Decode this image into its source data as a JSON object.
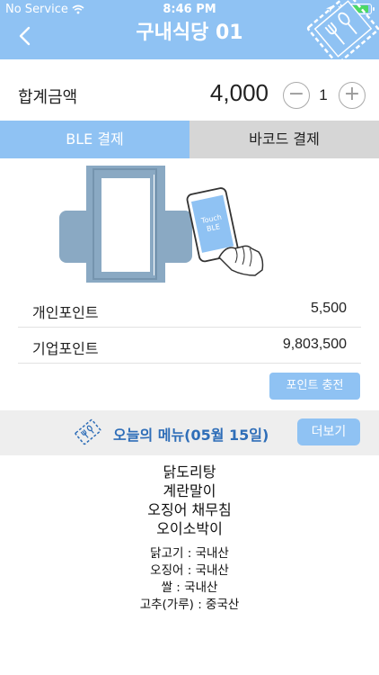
{
  "status_bar": {
    "carrier": "No Service",
    "time": "8:46 PM",
    "battery_level": 0.9
  },
  "header": {
    "title": "구내식당 01",
    "back_icon": "chevron-left-icon",
    "badge_icon": "fork-spoon-icon",
    "accent_color": "#8fc2f3"
  },
  "order": {
    "total_label": "합계금액",
    "total_amount": "4,000",
    "minus_label": "−",
    "quantity": "1",
    "plus_label": "+"
  },
  "tabs": [
    {
      "label": "BLE 결제",
      "active": true
    },
    {
      "label": "바코드 결제",
      "active": false
    }
  ],
  "illustration": {
    "phone_text_line1": "Touch",
    "phone_text_line2": "BLE"
  },
  "points": [
    {
      "label": "개인포인트",
      "value": "5,500"
    },
    {
      "label": "기업포인트",
      "value": "9,803,500"
    }
  ],
  "charge_button": "포인트 충전",
  "menu": {
    "title": "오늘의 메뉴(05월 15일)",
    "more_button": "더보기",
    "items": [
      "닭도리탕",
      "계란말이",
      "오징어 채무침",
      "오이소박이"
    ],
    "origins": [
      "닭고기 : 국내산",
      "오징어 : 국내산",
      "쌀 : 국내산",
      "고추(가루) : 중국산"
    ]
  }
}
